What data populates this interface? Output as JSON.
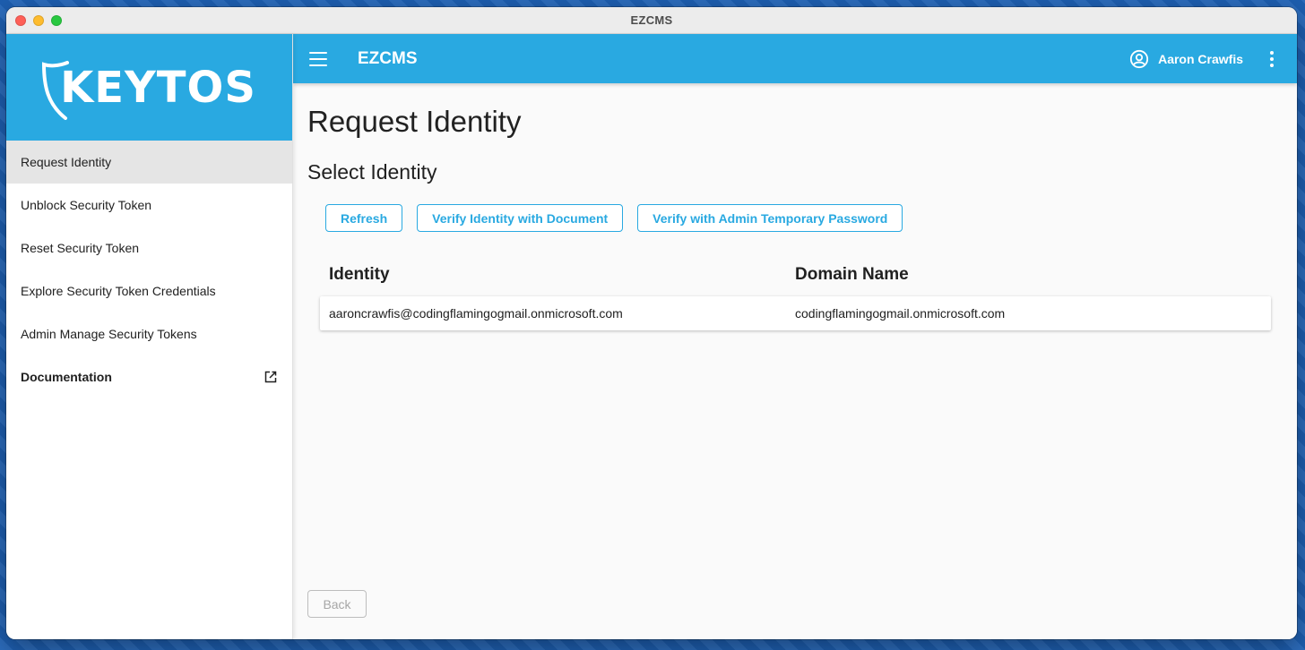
{
  "window": {
    "title": "EZCMS"
  },
  "sidebar": {
    "logo_text": "KEYTOS",
    "items": [
      {
        "label": "Request Identity"
      },
      {
        "label": "Unblock Security Token"
      },
      {
        "label": "Reset Security Token"
      },
      {
        "label": "Explore Security Token Credentials"
      },
      {
        "label": "Admin Manage Security Tokens"
      },
      {
        "label": "Documentation"
      }
    ]
  },
  "appbar": {
    "title": "EZCMS",
    "user_name": "Aaron Crawfis"
  },
  "main": {
    "page_title": "Request Identity",
    "section_title": "Select Identity",
    "buttons": {
      "refresh": "Refresh",
      "verify_document": "Verify Identity with Document",
      "verify_admin": "Verify with Admin Temporary Password"
    },
    "table": {
      "headers": [
        "Identity",
        "Domain Name"
      ],
      "rows": [
        [
          "aaroncrawfis@codingflamingogmail.onmicrosoft.com",
          "codingflamingogmail.onmicrosoft.com"
        ]
      ]
    },
    "back_label": "Back"
  },
  "colors": {
    "accent": "#29a9e1",
    "active_nav": "#e5e5e5"
  },
  "icons": [
    "menu-icon",
    "account-circle-icon",
    "more-vert-icon",
    "external-link-icon",
    "shield-logo-icon"
  ]
}
